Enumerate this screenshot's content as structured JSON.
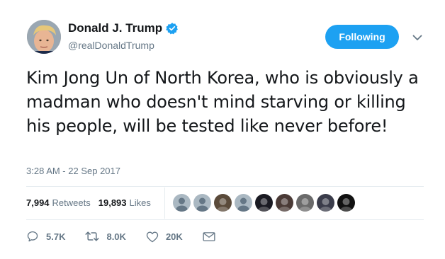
{
  "author": {
    "display_name": "Donald J. Trump",
    "handle": "@realDonaldTrump",
    "verified_icon": "verified-badge-icon",
    "avatar_icon": "profile-avatar"
  },
  "follow_button": {
    "label": "Following",
    "color": "#1da1f2"
  },
  "menu_icon": "chevron-down-icon",
  "tweet": {
    "text": "Kim Jong Un of North Korea, who is obviously a madman who doesn't mind starving or killing his people, will be tested like never before!",
    "timestamp": "3:28 AM - 22 Sep 2017"
  },
  "stats": {
    "retweets_count": "7,994",
    "retweets_label": "Retweets",
    "likes_count": "19,893",
    "likes_label": "Likes"
  },
  "likers": [
    {
      "icon": "default-avatar",
      "bg": "#aab8c2"
    },
    {
      "icon": "default-avatar",
      "bg": "#aab8c2"
    },
    {
      "icon": "photo-avatar",
      "bg": "#5a4a3a"
    },
    {
      "icon": "default-avatar",
      "bg": "#aab8c2"
    },
    {
      "icon": "photo-avatar",
      "bg": "#1a1a22"
    },
    {
      "icon": "photo-avatar",
      "bg": "#4a3a36"
    },
    {
      "icon": "photo-avatar",
      "bg": "#6a6a6a"
    },
    {
      "icon": "photo-avatar",
      "bg": "#3a3c4a"
    },
    {
      "icon": "photo-avatar",
      "bg": "#111111"
    }
  ],
  "actions": {
    "reply_count": "5.7K",
    "retweet_count": "8.0K",
    "like_count": "20K"
  },
  "colors": {
    "text": "#14171a",
    "muted": "#657786",
    "divider": "#e6ecf0"
  }
}
